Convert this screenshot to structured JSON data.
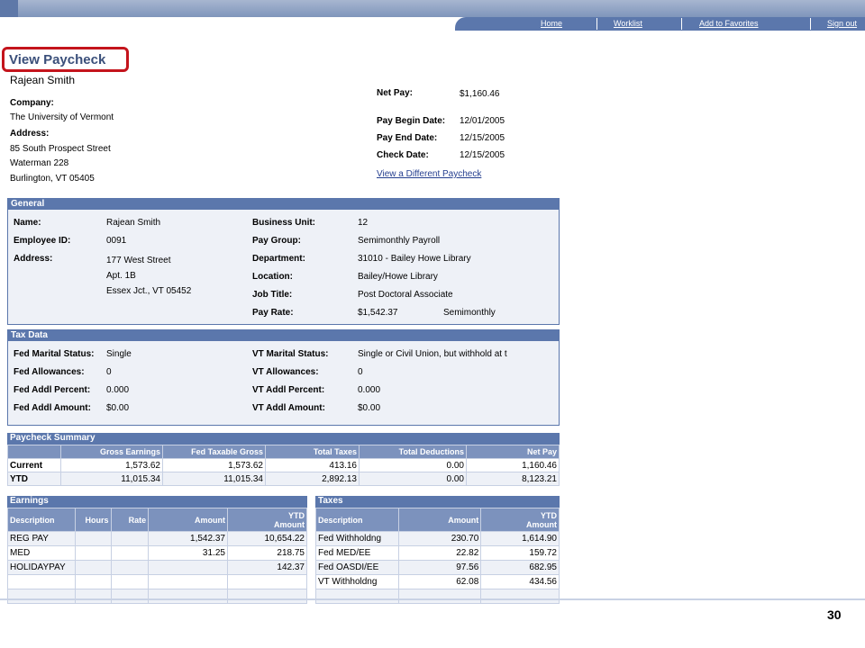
{
  "nav": {
    "home": "Home",
    "worklist": "Worklist",
    "favorites": "Add to Favorites",
    "signout": "Sign out"
  },
  "page": {
    "title": "View Paycheck",
    "employee_name": "Rajean Smith",
    "slide_number": "30"
  },
  "employer": {
    "company_label": "Company:",
    "company": "The University of Vermont",
    "address_label": "Address:",
    "address_line1": "85 South  Prospect Street",
    "address_line2": "Waterman 228",
    "address_line3": "Burlington, VT 05405"
  },
  "summary": {
    "net_pay_label": "Net Pay:",
    "net_pay": "$1,160.46",
    "pay_begin_label": "Pay Begin Date:",
    "pay_begin": "12/01/2005",
    "pay_end_label": "Pay End Date:",
    "pay_end": "12/15/2005",
    "check_date_label": "Check Date:",
    "check_date": "12/15/2005",
    "different_link": "View a Different Paycheck"
  },
  "general": {
    "title": "General",
    "name_label": "Name:",
    "name": "Rajean Smith",
    "empid_label": "Employee ID:",
    "empid": "0091",
    "address_label": "Address:",
    "addr1": "177 West Street",
    "addr2": "Apt. 1B",
    "addr3": "Essex Jct., VT 05452",
    "bu_label": "Business Unit:",
    "bu": "12",
    "paygroup_label": "Pay Group:",
    "paygroup": "Semimonthly Payroll",
    "dept_label": "Department:",
    "dept": "31010 - Bailey Howe Library",
    "location_label": "Location:",
    "location": "Bailey/Howe Library",
    "jobtitle_label": "Job Title:",
    "jobtitle": "Post Doctoral Associate",
    "payrate_label": "Pay Rate:",
    "payrate": "$1,542.37",
    "payfreq": "Semimonthly"
  },
  "tax": {
    "title": "Tax Data",
    "fed_marital_label": "Fed Marital Status:",
    "fed_marital": "Single",
    "fed_allow_label": "Fed Allowances:",
    "fed_allow": "0",
    "fed_pct_label": "Fed Addl Percent:",
    "fed_pct": "0.000",
    "fed_amt_label": "Fed Addl Amount:",
    "fed_amt": "$0.00",
    "vt_marital_label": "VT Marital Status:",
    "vt_marital": "Single or Civil Union, but withhold at t",
    "vt_allow_label": "VT Allowances:",
    "vt_allow": "0",
    "vt_pct_label": "VT Addl Percent:",
    "vt_pct": "0.000",
    "vt_amt_label": "VT Addl Amount:",
    "vt_amt": "$0.00"
  },
  "paycheck_summary": {
    "title": "Paycheck Summary",
    "headers": [
      "",
      "Gross Earnings",
      "Fed Taxable Gross",
      "Total Taxes",
      "Total Deductions",
      "Net Pay"
    ],
    "rows": [
      [
        "Current",
        "1,573.62",
        "1,573.62",
        "413.16",
        "0.00",
        "1,160.46"
      ],
      [
        "YTD",
        "11,015.34",
        "11,015.34",
        "2,892.13",
        "0.00",
        "8,123.21"
      ]
    ]
  },
  "earnings": {
    "title": "Earnings",
    "headers": [
      "Description",
      "Hours",
      "Rate",
      "Amount",
      "YTD",
      "Amount"
    ],
    "rows": [
      [
        "REG PAY",
        "",
        "",
        "1,542.37",
        "10,654.22"
      ],
      [
        "MED",
        "",
        "",
        "31.25",
        "218.75"
      ],
      [
        "HOLIDAYPAY",
        "",
        "",
        "",
        "142.37"
      ],
      [
        "",
        "",
        "",
        "",
        ""
      ],
      [
        "",
        "",
        "",
        "",
        ""
      ]
    ]
  },
  "taxes": {
    "title": "Taxes",
    "headers": [
      "Description",
      "Amount",
      "YTD",
      "Amount"
    ],
    "rows": [
      [
        "Fed Withholdng",
        "230.70",
        "1,614.90"
      ],
      [
        "Fed MED/EE",
        "22.82",
        "159.72"
      ],
      [
        "Fed OASDI/EE",
        "97.56",
        "682.95"
      ],
      [
        "VT Withholdng",
        "62.08",
        "434.56"
      ],
      [
        "",
        "",
        ""
      ]
    ]
  }
}
